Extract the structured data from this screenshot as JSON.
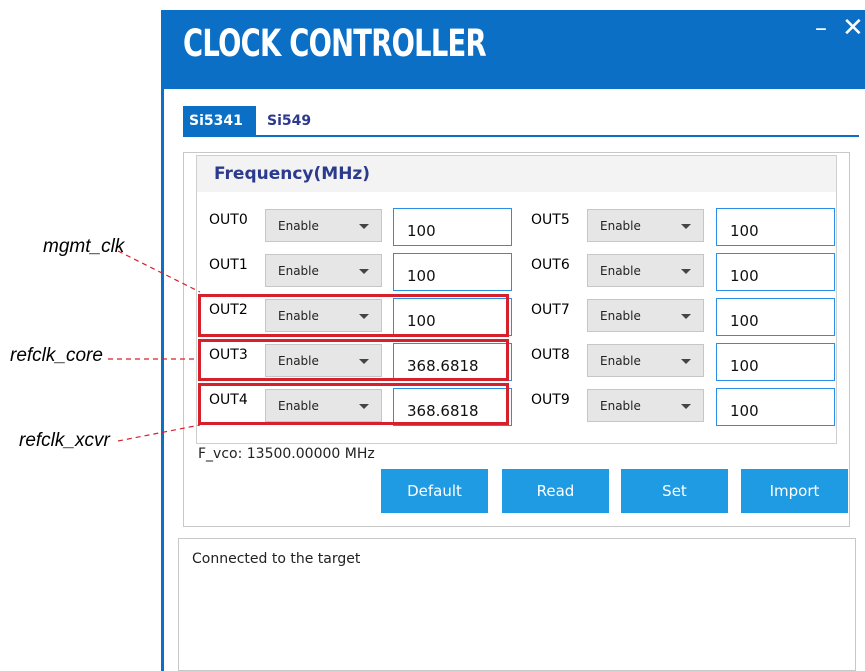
{
  "window": {
    "title": "CLOCK CONTROLLER",
    "minimize_glyph": "–",
    "close_glyph": "✕"
  },
  "tabs": [
    {
      "label": "Si5341",
      "active": true
    },
    {
      "label": "Si549",
      "active": false
    }
  ],
  "frequency_panel": {
    "title": "Frequency(MHz)",
    "outputs": [
      {
        "label": "OUT0",
        "mode": "Enable",
        "value": "100"
      },
      {
        "label": "OUT1",
        "mode": "Enable",
        "value": "100"
      },
      {
        "label": "OUT2",
        "mode": "Enable",
        "value": "100"
      },
      {
        "label": "OUT3",
        "mode": "Enable",
        "value": "368.6818"
      },
      {
        "label": "OUT4",
        "mode": "Enable",
        "value": "368.6818"
      },
      {
        "label": "OUT5",
        "mode": "Enable",
        "value": "100"
      },
      {
        "label": "OUT6",
        "mode": "Enable",
        "value": "100"
      },
      {
        "label": "OUT7",
        "mode": "Enable",
        "value": "100"
      },
      {
        "label": "OUT8",
        "mode": "Enable",
        "value": "100"
      },
      {
        "label": "OUT9",
        "mode": "Enable",
        "value": "100"
      }
    ],
    "fvco_text": "F_vco: 13500.00000 MHz"
  },
  "buttons": {
    "default": "Default",
    "read": "Read",
    "set": "Set",
    "import": "Import"
  },
  "status": {
    "text": "Connected to the target"
  },
  "annotations": [
    {
      "label": "mgmt_clk",
      "target": "OUT2"
    },
    {
      "label": "refclk_core",
      "target": "OUT3"
    },
    {
      "label": "refclk_xcvr",
      "target": "OUT4"
    }
  ],
  "colors": {
    "title_bar": "#0b6fc5",
    "button": "#1e9be3",
    "highlight": "#d6202b",
    "heading_text": "#2b3a8c"
  }
}
